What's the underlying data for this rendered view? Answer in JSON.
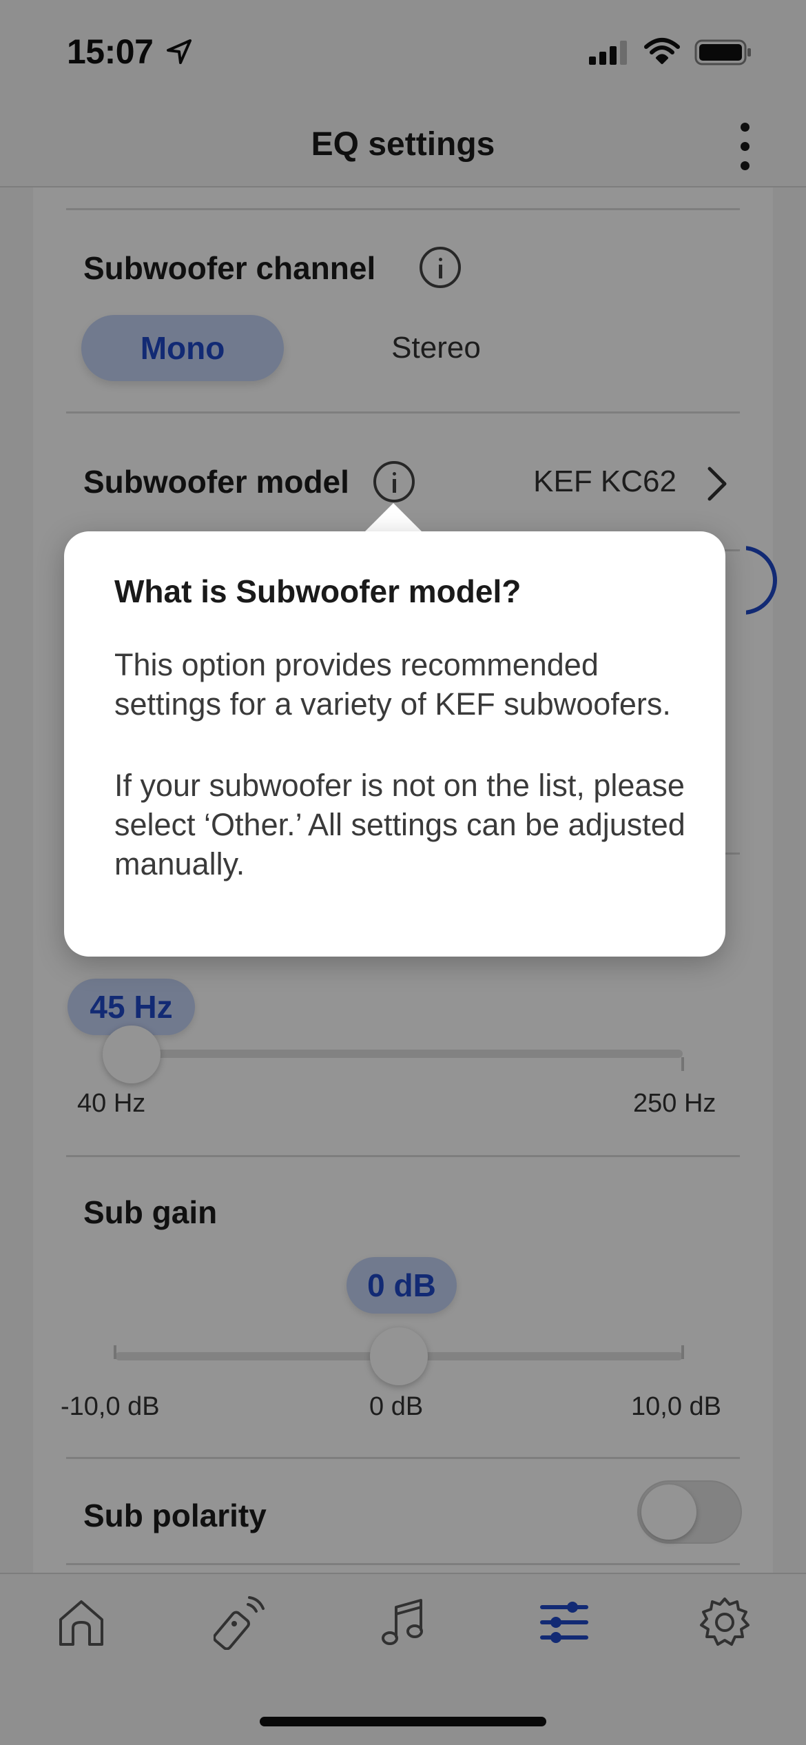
{
  "status_bar": {
    "time": "15:07",
    "location_icon": "location-arrow-icon",
    "signal_icon": "cellular-signal-icon",
    "wifi_icon": "wifi-icon",
    "battery_icon": "battery-icon"
  },
  "header": {
    "title": "EQ settings",
    "more_icon": "more-vertical-icon"
  },
  "subwoofer_channel": {
    "title": "Subwoofer channel",
    "options": [
      "Mono",
      "Stereo"
    ],
    "selected": "Mono"
  },
  "subwoofer_model": {
    "title": "Subwoofer model",
    "value": "KEF KC62"
  },
  "crossover": {
    "value_label": "45 Hz",
    "value": 45,
    "min_label": "40 Hz",
    "max_label": "250 Hz",
    "min": 40,
    "max": 250
  },
  "sub_gain": {
    "title": "Sub gain",
    "value_label": "0 dB",
    "value": 0,
    "min_label": "-10,0 dB",
    "mid_label": "0 dB",
    "max_label": "10,0 dB",
    "min": -10,
    "max": 10
  },
  "sub_polarity": {
    "title": "Sub polarity",
    "enabled": false
  },
  "popover": {
    "title": "What is Subwoofer model?",
    "paragraph_1": "This option provides recommended settings for a variety of KEF subwoofers.",
    "paragraph_2": "If your subwoofer is not on the list, please select ‘Other.’ All settings can be adjusted manually."
  },
  "tab_bar": {
    "tabs": [
      {
        "icon": "home-icon",
        "active": false
      },
      {
        "icon": "remote-icon",
        "active": false
      },
      {
        "icon": "music-note-icon",
        "active": false
      },
      {
        "icon": "equalizer-sliders-icon",
        "active": true
      },
      {
        "icon": "settings-gear-icon",
        "active": false
      }
    ]
  },
  "colors": {
    "accent": "#1f49c8",
    "chip_background": "#c3d2f5",
    "overlay": "rgba(0,0,0,0.42)"
  }
}
